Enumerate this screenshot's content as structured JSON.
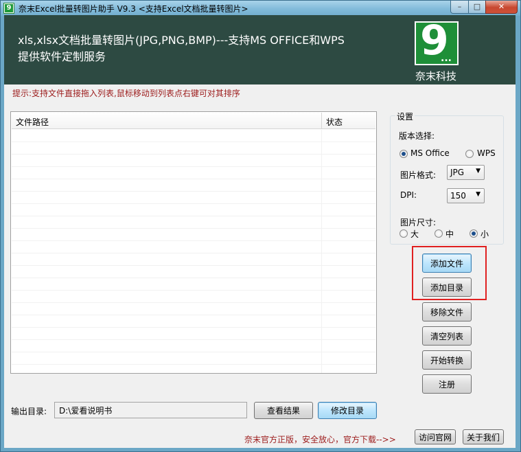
{
  "window": {
    "title": "奈末Excel批量转图片助手 V9.3 <支持Excel文档批量转图片>",
    "app_icon_glyph": "9",
    "min_glyph": "–",
    "max_glyph": "□",
    "close_glyph": "✕"
  },
  "banner": {
    "line1": "xls,xlsx文档批量转图片(JPG,PNG,BMP)---支持MS OFFICE和WPS",
    "line2": "提供软件定制服务",
    "logo_glyph": "9",
    "logo_dots": "...",
    "company": "奈末科技"
  },
  "hint": "提示:支持文件直接拖入列表,鼠标移动到列表点右键可对其排序",
  "file_list": {
    "columns": [
      "文件路径",
      "状态"
    ],
    "rows": []
  },
  "settings": {
    "legend": "设置",
    "version_label": "版本选择:",
    "version_options": [
      "MS Office",
      "WPS"
    ],
    "version_selected": "MS Office",
    "format_label": "图片格式:",
    "format_value": "JPG",
    "dpi_label": "DPI:",
    "dpi_value": "150",
    "size_label": "图片尺寸:",
    "size_options": [
      "大",
      "中",
      "小"
    ],
    "size_selected": "小",
    "arrow_glyph": "▼"
  },
  "actions": {
    "add_file": "添加文件",
    "add_folder": "添加目录",
    "remove_file": "移除文件",
    "clear_list": "清空列表",
    "start": "开始转换",
    "register": "注册"
  },
  "output": {
    "label": "输出目录:",
    "path": "D:\\爱看说明书",
    "view_results": "查看结果",
    "change_dir": "修改目录"
  },
  "footer": {
    "text": "奈末官方正版，安全放心，官方下载-->>",
    "website": "访问官网",
    "about": "关于我们"
  },
  "colors": {
    "banner_bg": "#2d4a42",
    "logo_green": "#1e8f38",
    "hint_red": "#9c1b1b",
    "highlight_red": "#e02020"
  }
}
